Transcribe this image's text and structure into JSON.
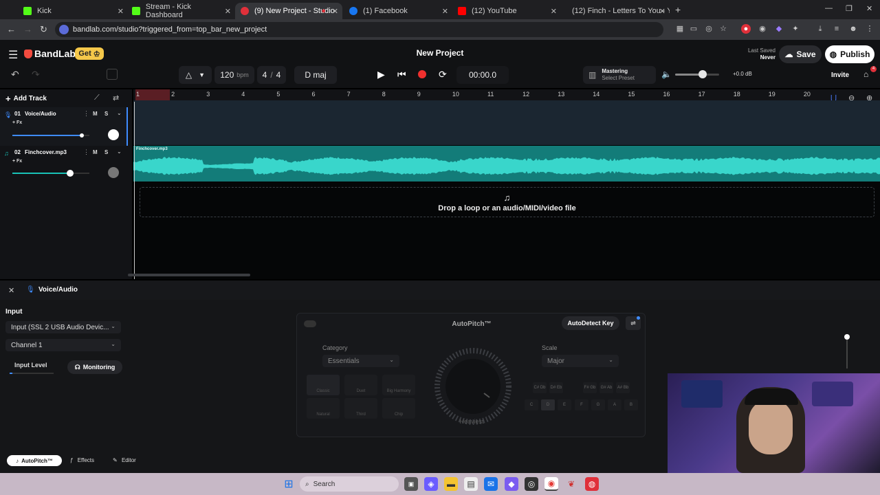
{
  "browser": {
    "tabs": [
      {
        "label": "Kick",
        "color": "#53fc18"
      },
      {
        "label": "Stream - Kick Dashboard",
        "color": "#53fc18"
      },
      {
        "label": "(9) New Project - Studio",
        "color": "#e0303a"
      },
      {
        "label": "(1) Facebook",
        "color": "#1877f2"
      },
      {
        "label": "(12) YouTube",
        "color": "#ff0000"
      },
      {
        "label": "(12) Finch - Letters To You - You",
        "color": "#ff0000"
      }
    ],
    "url": "bandlab.com/studio?triggered_from=top_bar_new_project"
  },
  "app": {
    "brand": "BandLab",
    "get_label": "Get",
    "project_title": "New Project",
    "last_saved_label": "Last Saved",
    "last_saved_value": "Never",
    "save_label": "Save",
    "publish_label": "Publish",
    "invite_label": "Invite",
    "gift_badge": "4"
  },
  "transport": {
    "bpm": "120",
    "bpm_unit": "bpm",
    "time_sig_num": "4",
    "time_sig_sep": "/",
    "time_sig_den": "4",
    "key": "D maj",
    "time": "00:00.0",
    "mastering_label": "Mastering",
    "mastering_preset": "Select Preset",
    "gain": "+0.0 dB",
    "volume_level": 0.62
  },
  "tracks_header": {
    "add_track_label": "Add Track"
  },
  "tracks": [
    {
      "number": "01",
      "name": "Voice/Audio",
      "fx": "+ Fx",
      "mute": "M",
      "solo": "S",
      "volume": 0.9,
      "color": "#3f8cff"
    },
    {
      "number": "02",
      "name": "Finchcover.mp3",
      "fx": "+ Fx",
      "mute": "M",
      "solo": "S",
      "volume": 0.75,
      "color": "#19c3b8"
    }
  ],
  "ruler": [
    "1",
    "2",
    "3",
    "4",
    "5",
    "6",
    "7",
    "8",
    "9",
    "10",
    "11",
    "12",
    "13",
    "14",
    "15",
    "16",
    "17",
    "18",
    "19",
    "20"
  ],
  "clip_label": "Finchcover.mp3",
  "dropzone_text": "Drop a loop or an audio/MIDI/video file",
  "panel": {
    "track_name": "Voice/Audio",
    "input_heading": "Input",
    "input_device": "Input (SSL 2 USB Audio Devic...",
    "channel": "Channel 1",
    "input_level_label": "Input Level",
    "monitoring_label": "Monitoring"
  },
  "autopitch": {
    "title": "AutoPitch™",
    "autodetect_label": "AutoDetect Key",
    "category_label": "Category",
    "category_value": "Essentials",
    "scale_label": "Scale",
    "scale_value": "Major",
    "knob_label": "Heaviest",
    "effects": [
      "Classic",
      "Duet",
      "Big Harmony",
      "Natural",
      "Third",
      "Chip"
    ],
    "key_top": [
      "C#\nDb",
      "D#\nEb",
      "F#\nGb",
      "G#\nAb",
      "A#\nBb"
    ],
    "key_bottom": [
      "C",
      "D",
      "E",
      "F",
      "G",
      "A",
      "B"
    ]
  },
  "bottom_tabs": {
    "autopitch": "AutoPitch™",
    "effects": "Effects",
    "editor": "Editor"
  },
  "taskbar": {
    "search_label": "Search"
  }
}
